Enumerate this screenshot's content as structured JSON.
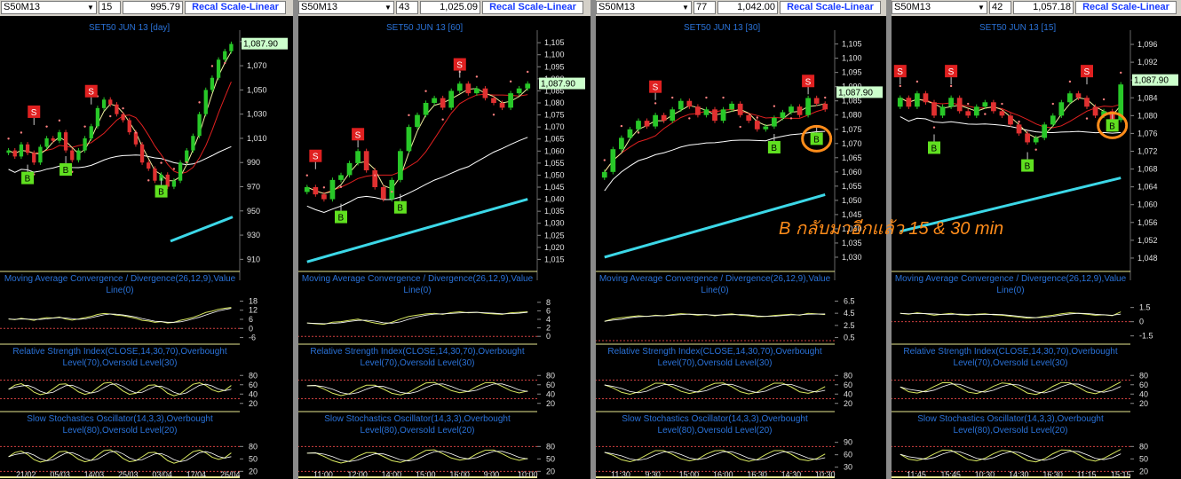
{
  "colors": {
    "candle_up": "#28c828",
    "candle_down": "#e03030",
    "ma_fast": "#f0f0a0",
    "ma_mid": "#e02020",
    "ma_slow": "#ffffff",
    "trend": "#3cd8e8",
    "sar": "#ff8080",
    "signal_buy": "#60e020",
    "signal_sell": "#e02020",
    "sub_line": "#d8e860",
    "highlight": "#ff8c1a",
    "label_text": "#2a72d8",
    "price_label_bg": "#ccffcc"
  },
  "recal_label": "Recal Scale-Linear",
  "indicators": {
    "macd": "Moving Average Convergence / Divergence(26,12,9),Value Line(0)",
    "rsi": "Relative Strength Index(CLOSE,14,30,70),Overbought Level(70),Oversold Level(30)",
    "stoch": "Slow Stochastics Oscillator(14,3,3),Overbought Level(80),Oversold Level(20)"
  },
  "annotation": "B กลับมาอีกแล้ว 15 & 30 min",
  "chart_data": [
    {
      "type": "candlestick",
      "symbol": "S50M13",
      "interval": "15",
      "header_price": "995.79",
      "title": "SET50 JUN 13  [day]",
      "last_price": "1,087.90",
      "ylim": [
        900,
        1095
      ],
      "price_ticks": [
        "1,090",
        "1,070",
        "1,050",
        "1,030",
        "1,010",
        "990",
        "970",
        "950",
        "930",
        "910"
      ],
      "x_ticks": [
        "21/02",
        "05/03",
        "14/03",
        "25/03",
        "03/04",
        "17/04",
        "26/04"
      ],
      "close": [
        1000,
        995,
        1005,
        998,
        990,
        1003,
        1010,
        1008,
        1015,
        1000,
        992,
        1000,
        1010,
        1020,
        1035,
        1042,
        1038,
        1030,
        1025,
        1015,
        1005,
        990,
        985,
        975,
        980,
        970,
        975,
        990,
        1000,
        1012,
        1030,
        1050,
        1060,
        1075,
        1082,
        1088
      ],
      "buy_signals": [
        {
          "i": 3,
          "price": 978
        },
        {
          "i": 9,
          "price": 985
        },
        {
          "i": 24,
          "price": 967
        }
      ],
      "sell_signals": [
        {
          "i": 4,
          "price": 1032
        },
        {
          "i": 13,
          "price": 1049
        }
      ],
      "macd_ticks": [
        "18",
        "12",
        "6",
        "0",
        "-6"
      ],
      "macd_range": [
        -8,
        20
      ],
      "rsi_ticks": [
        "80",
        "60",
        "40",
        "20"
      ],
      "rsi_levels": [
        70,
        30
      ],
      "stoch_ticks": [
        "80",
        "50",
        "20"
      ],
      "stoch_levels": [
        80,
        20
      ],
      "trend_segment": [
        1000,
        925,
        1035,
        945
      ]
    },
    {
      "type": "candlestick",
      "symbol": "S50M13",
      "interval": "43",
      "header_price": "1,025.09",
      "title": "SET50 JUN 13  [60]",
      "last_price": "1,087.90",
      "ylim": [
        1010,
        1108
      ],
      "price_ticks": [
        "1,105",
        "1,100",
        "1,095",
        "1,090",
        "1,085",
        "1,080",
        "1,075",
        "1,070",
        "1,065",
        "1,060",
        "1,055",
        "1,050",
        "1,045",
        "1,040",
        "1,035",
        "1,030",
        "1,025",
        "1,020",
        "1,015"
      ],
      "x_ticks": [
        "11:00",
        "12:00",
        "14:00",
        "15:00",
        "16:00",
        "9:00",
        "10:00"
      ],
      "close": [
        1045,
        1042,
        1040,
        1048,
        1050,
        1055,
        1060,
        1052,
        1045,
        1040,
        1048,
        1060,
        1070,
        1075,
        1080,
        1082,
        1078,
        1085,
        1088,
        1084,
        1086,
        1082,
        1080,
        1078,
        1084,
        1086,
        1088
      ],
      "buy_signals": [
        {
          "i": 4,
          "price": 1033
        },
        {
          "i": 11,
          "price": 1037
        }
      ],
      "sell_signals": [
        {
          "i": 1,
          "price": 1058
        },
        {
          "i": 6,
          "price": 1067
        },
        {
          "i": 18,
          "price": 1096
        }
      ],
      "macd_ticks": [
        "8",
        "6",
        "4",
        "2",
        "0"
      ],
      "macd_range": [
        -1,
        9
      ],
      "rsi_ticks": [
        "80",
        "60",
        "40",
        "20"
      ],
      "rsi_levels": [
        70,
        30
      ],
      "stoch_ticks": [
        "80",
        "50",
        "20"
      ],
      "stoch_levels": [
        80,
        20
      ],
      "trend_segment": [
        1,
        1014,
        27,
        1040
      ]
    },
    {
      "type": "candlestick",
      "symbol": "S50M13",
      "interval": "77",
      "header_price": "1,042.00",
      "title": "SET50 JUN 13  [30]",
      "last_price": "1,087.90",
      "ylim": [
        1025,
        1108
      ],
      "price_ticks": [
        "1,105",
        "1,100",
        "1,095",
        "1,090",
        "1,085",
        "1,080",
        "1,075",
        "1,070",
        "1,065",
        "1,060",
        "1,055",
        "1,050",
        "1,045",
        "1,040",
        "1,035",
        "1,030"
      ],
      "x_ticks": [
        "11:30",
        "9:30",
        "15:00",
        "16:00",
        "16:30",
        "14:30",
        "10:30"
      ],
      "close": [
        1060,
        1068,
        1072,
        1075,
        1078,
        1076,
        1080,
        1078,
        1082,
        1085,
        1083,
        1080,
        1082,
        1078,
        1082,
        1084,
        1080,
        1078,
        1075,
        1076,
        1079,
        1081,
        1083,
        1080,
        1086,
        1084,
        1082
      ],
      "buy_signals": [
        {
          "i": 20,
          "price": 1069
        },
        {
          "i": 25,
          "price": 1072
        }
      ],
      "sell_signals": [
        {
          "i": 6,
          "price": 1090
        },
        {
          "i": 24,
          "price": 1092
        }
      ],
      "macd_ticks": [
        "6.5",
        "4.5",
        "2.5",
        "0.5"
      ],
      "macd_range": [
        0,
        7
      ],
      "rsi_ticks": [
        "80",
        "60",
        "40",
        "20"
      ],
      "rsi_levels": [
        70,
        30
      ],
      "stoch_ticks": [
        "90",
        "60",
        "30"
      ],
      "stoch_levels": [
        80,
        20
      ],
      "trend_segment": [
        1,
        1030,
        27,
        1052
      ]
    },
    {
      "type": "candlestick",
      "symbol": "S50M13",
      "interval": "42",
      "header_price": "1,057.18",
      "title": "SET50 JUN 13  [15]",
      "last_price": "1,087.90",
      "ylim": [
        1045,
        1098
      ],
      "price_ticks": [
        "1,096",
        "1,092",
        "1,088",
        "1,084",
        "1,080",
        "1,076",
        "1,072",
        "1,068",
        "1,064",
        "1,060",
        "1,056",
        "1,052",
        "1,048"
      ],
      "x_ticks": [
        "11:45",
        "15:45",
        "10:30",
        "14:30",
        "16:30",
        "11:15",
        "15:15"
      ],
      "close": [
        1084,
        1082,
        1085,
        1083,
        1080,
        1082,
        1084,
        1081,
        1080,
        1082,
        1083,
        1081,
        1080,
        1078,
        1076,
        1074,
        1075,
        1078,
        1080,
        1083,
        1085,
        1084,
        1082,
        1080,
        1081,
        1079,
        1087
      ],
      "buy_signals": [
        {
          "i": 4,
          "price": 1073
        },
        {
          "i": 15,
          "price": 1069
        },
        {
          "i": 25,
          "price": 1078
        }
      ],
      "sell_signals": [
        {
          "i": 0,
          "price": 1090
        },
        {
          "i": 6,
          "price": 1090
        },
        {
          "i": 22,
          "price": 1090
        }
      ],
      "macd_ticks": [
        "1.5",
        "0",
        "-1.5"
      ],
      "macd_range": [
        -2,
        2.5
      ],
      "rsi_ticks": [
        "80",
        "60",
        "40",
        "20"
      ],
      "rsi_levels": [
        70,
        30
      ],
      "stoch_ticks": [
        "80",
        "50",
        "20"
      ],
      "stoch_levels": [
        80,
        20
      ],
      "trend_segment": [
        1,
        1054,
        27,
        1066
      ]
    }
  ]
}
